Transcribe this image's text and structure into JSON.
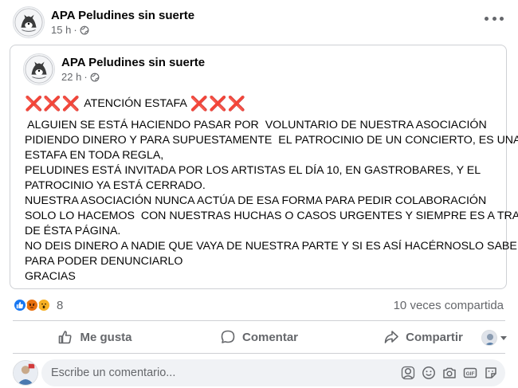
{
  "post": {
    "author": "APA Peludines sin suerte",
    "time": "15 h",
    "separator": "·"
  },
  "shared": {
    "author": "APA Peludines sin suerte",
    "time": "22 h",
    "separator": "·",
    "headline_marks_left": "❌❌❌",
    "headline": "ATENCIÓN ESTAFA",
    "headline_marks_right": "❌❌❌",
    "lines": [
      " ALGUIEN SE ESTÁ HACIENDO PASAR POR  VOLUNTARIO DE NUESTRA ASOCIACIÓN",
      "PIDIENDO DINERO Y PARA SUPUESTAMENTE  EL PATROCINIO DE UN CONCIERTO, ES UNA",
      "ESTAFA EN TODA REGLA,",
      "PELUDINES ESTÁ INVITADA POR LOS ARTISTAS EL DÍA 10, EN GASTROBARES, Y EL",
      "PATROCINIO YA ESTÁ CERRADO.",
      "NUESTRA ASOCIACIÓN NUNCA ACTÚA DE ESA FORMA PARA PEDIR COLABORACIÓN",
      "SOLO LO HACEMOS  CON NUESTRAS HUCHAS O CASOS URGENTES Y SIEMPRE ES A TRAVÉS",
      "DE ÉSTA PÁGINA.",
      "NO DEIS DINERO A NADIE QUE VAYA DE NUESTRA PARTE Y SI ES ASÍ HACÉRNOSLO SABER",
      "PARA PODER DENUNCIARLO",
      "GRACIAS"
    ]
  },
  "stats": {
    "reaction_count": "8",
    "shares": "10 veces compartida",
    "reactions": [
      "like-icon",
      "angry-icon",
      "wow-icon"
    ]
  },
  "actions": {
    "like": "Me gusta",
    "comment": "Comentar",
    "share": "Compartir"
  },
  "composer": {
    "placeholder": "Escribe un comentario..."
  },
  "colors": {
    "accent": "#1877f2",
    "secondary_text": "#65676b",
    "x_mark": "#de2c38"
  }
}
